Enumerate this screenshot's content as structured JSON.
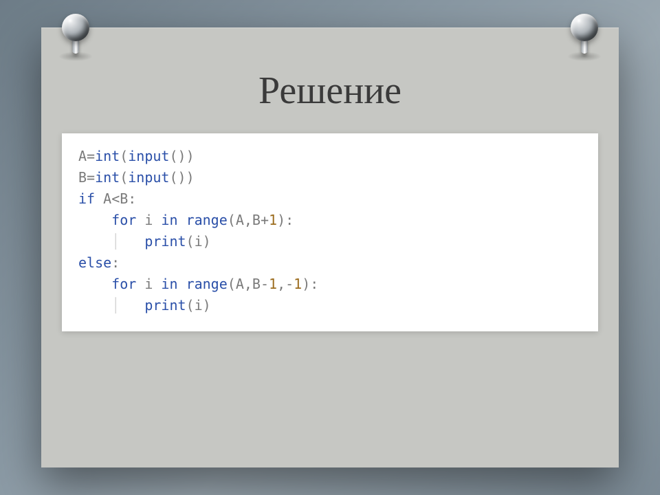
{
  "title": "Решение",
  "code_lines": [
    {
      "cls": "txt",
      "text": "A"
    },
    {
      "cls": "op",
      "text": "="
    },
    {
      "cls": "kw",
      "text": "int"
    },
    {
      "cls": "op",
      "text": "("
    },
    {
      "cls": "kw",
      "text": "input"
    },
    {
      "cls": "op",
      "text": "())"
    }
  ],
  "lines": [
    [
      {
        "cls": "txt",
        "t": "A"
      },
      {
        "cls": "op",
        "t": "="
      },
      {
        "cls": "kw",
        "t": "int"
      },
      {
        "cls": "op",
        "t": "("
      },
      {
        "cls": "kw",
        "t": "input"
      },
      {
        "cls": "op",
        "t": "())"
      }
    ],
    [
      {
        "cls": "txt",
        "t": "B"
      },
      {
        "cls": "op",
        "t": "="
      },
      {
        "cls": "kw",
        "t": "int"
      },
      {
        "cls": "op",
        "t": "("
      },
      {
        "cls": "kw",
        "t": "input"
      },
      {
        "cls": "op",
        "t": "())"
      }
    ],
    [
      {
        "cls": "kw",
        "t": "if"
      },
      {
        "cls": "txt",
        "t": " A"
      },
      {
        "cls": "op",
        "t": "<"
      },
      {
        "cls": "txt",
        "t": "B"
      },
      {
        "cls": "op",
        "t": ":"
      }
    ],
    [
      {
        "cls": "guide",
        "t": "    "
      },
      {
        "cls": "kw",
        "t": "for"
      },
      {
        "cls": "txt",
        "t": " i "
      },
      {
        "cls": "kw",
        "t": "in"
      },
      {
        "cls": "txt",
        "t": " "
      },
      {
        "cls": "kw",
        "t": "range"
      },
      {
        "cls": "op",
        "t": "("
      },
      {
        "cls": "txt",
        "t": "A"
      },
      {
        "cls": "op",
        "t": ","
      },
      {
        "cls": "txt",
        "t": "B"
      },
      {
        "cls": "op",
        "t": "+"
      },
      {
        "cls": "num",
        "t": "1"
      },
      {
        "cls": "op",
        "t": "):"
      }
    ],
    [
      {
        "cls": "guide",
        "t": "    │   "
      },
      {
        "cls": "kw",
        "t": "print"
      },
      {
        "cls": "op",
        "t": "("
      },
      {
        "cls": "txt",
        "t": "i"
      },
      {
        "cls": "op",
        "t": ")"
      }
    ],
    [
      {
        "cls": "kw",
        "t": "else"
      },
      {
        "cls": "op",
        "t": ":"
      }
    ],
    [
      {
        "cls": "guide",
        "t": "    "
      },
      {
        "cls": "kw",
        "t": "for"
      },
      {
        "cls": "txt",
        "t": " i "
      },
      {
        "cls": "kw",
        "t": "in"
      },
      {
        "cls": "txt",
        "t": " "
      },
      {
        "cls": "kw",
        "t": "range"
      },
      {
        "cls": "op",
        "t": "("
      },
      {
        "cls": "txt",
        "t": "A"
      },
      {
        "cls": "op",
        "t": ","
      },
      {
        "cls": "txt",
        "t": "B"
      },
      {
        "cls": "op",
        "t": "-"
      },
      {
        "cls": "num",
        "t": "1"
      },
      {
        "cls": "op",
        "t": ","
      },
      {
        "cls": "op",
        "t": "-"
      },
      {
        "cls": "num",
        "t": "1"
      },
      {
        "cls": "op",
        "t": "):"
      }
    ],
    [
      {
        "cls": "guide",
        "t": "    │   "
      },
      {
        "cls": "kw",
        "t": "print"
      },
      {
        "cls": "op",
        "t": "("
      },
      {
        "cls": "txt",
        "t": "i"
      },
      {
        "cls": "op",
        "t": ")"
      }
    ]
  ]
}
